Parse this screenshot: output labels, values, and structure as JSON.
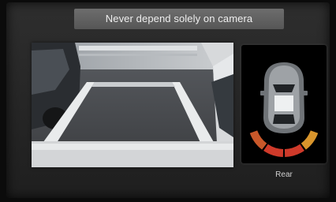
{
  "warning": {
    "text": "Never depend solely on camera"
  },
  "sensor": {
    "label": "Rear",
    "zones": [
      {
        "name": "outer-left",
        "color": "#c9582a"
      },
      {
        "name": "center-left",
        "color": "#cf3a2a"
      },
      {
        "name": "center-right",
        "color": "#cf3a2a"
      },
      {
        "name": "outer-right",
        "color": "#d8952c"
      }
    ]
  },
  "camera": {
    "icon": "rear-camera-feed"
  }
}
